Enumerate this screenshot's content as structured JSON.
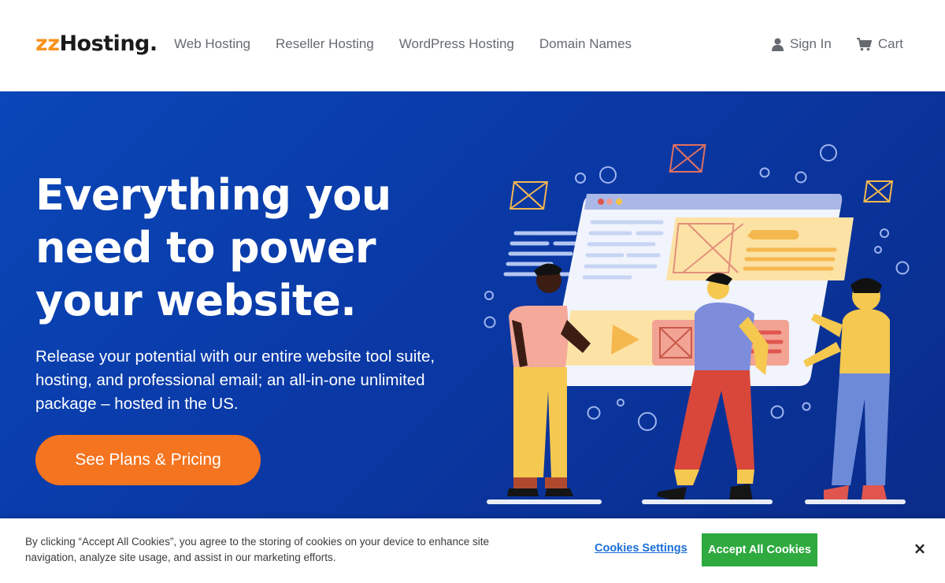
{
  "header": {
    "logo_prefix": "zz",
    "logo_main": "Hosting.",
    "nav": [
      {
        "label": "Web Hosting"
      },
      {
        "label": "Reseller Hosting"
      },
      {
        "label": "WordPress Hosting"
      },
      {
        "label": "Domain Names"
      }
    ],
    "sign_in": "Sign In",
    "cart": "Cart",
    "icons": {
      "sign_in": "user-icon",
      "cart": "cart-icon"
    }
  },
  "hero": {
    "title": "Everything you need to power your website.",
    "subtitle": "Release your potential with our entire website tool suite, hosting, and professional email; an all-in-one unlimited package – hosted in the US.",
    "cta": "See Plans & Pricing"
  },
  "cookie_banner": {
    "text": "By clicking “Accept All Cookies”, you agree to the storing of cookies on your device to enhance site navigation, analyze site usage, and assist in our marketing efforts.",
    "settings": "Cookies Settings",
    "accept": "Accept All Cookies",
    "close": "×"
  },
  "colors": {
    "brand_accent": "#f7931e",
    "hero_bg": "#0a3aa8",
    "cta": "#f5741f",
    "accept": "#2eaa3f",
    "link": "#1a6fd6"
  }
}
